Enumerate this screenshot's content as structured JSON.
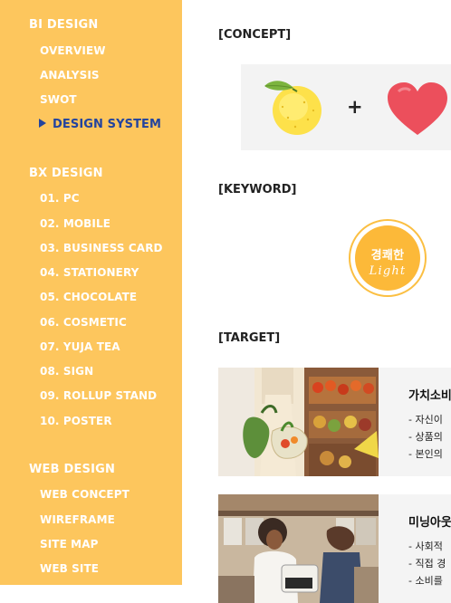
{
  "sidebar": {
    "sections": [
      {
        "title": "BI DESIGN",
        "items": [
          "OVERVIEW",
          "ANALYSIS",
          "SWOT",
          "DESIGN SYSTEM"
        ]
      },
      {
        "title": "BX DESIGN",
        "items": [
          "01. PC",
          "02. MOBILE",
          "03. BUSINESS CARD",
          "04. STATIONERY",
          "05. CHOCOLATE",
          "06. COSMETIC",
          "07. YUJA TEA",
          "08. SIGN",
          "09. ROLLUP STAND",
          "10. POSTER"
        ]
      },
      {
        "title": "WEB DESIGN",
        "items": [
          "WEB CONCEPT",
          "WIREFRAME",
          "SITE MAP",
          "WEB SITE"
        ]
      }
    ],
    "active_item": "DESIGN SYSTEM"
  },
  "main": {
    "concept": {
      "heading": "[CONCEPT]",
      "plus": "+",
      "icons": [
        "yuja-icon",
        "heart-icon"
      ]
    },
    "keyword": {
      "heading": "[KEYWORD]",
      "badge_korean": "경쾌한",
      "badge_english": "Light"
    },
    "target": {
      "heading": "[TARGET]",
      "cards": [
        {
          "title": "가치소비",
          "lines": [
            "- 자신이",
            "- 상품의",
            "- 본인의"
          ]
        },
        {
          "title": "미닝아웃",
          "lines": [
            "- 사회적",
            "- 직접 경",
            "- 소비를"
          ]
        }
      ]
    }
  },
  "colors": {
    "sidebar_bg": "#fdc65d",
    "active_nav": "#23449e",
    "badge": "#fcb939",
    "panel_bg": "#f3f3f3"
  }
}
